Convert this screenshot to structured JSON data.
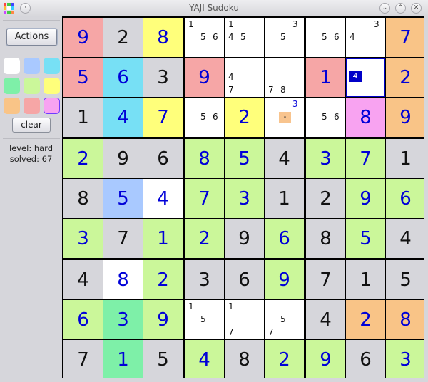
{
  "window": {
    "title": "YAJI Sudoku"
  },
  "colors": {
    "white": "#ffffff",
    "gray": "#d6d6db",
    "blue": "#a9c9ff",
    "cyan": "#77e0f5",
    "green": "#7ef0a8",
    "lime": "#cbf79a",
    "yellow": "#ffff7b",
    "orange": "#f9c487",
    "red": "#f6a6a6",
    "pink": "#f8a3f1"
  },
  "sidebar": {
    "actions_label": "Actions",
    "palette": [
      {
        "name": "white",
        "color": "#ffffff",
        "selected": false
      },
      {
        "name": "blue",
        "color": "#a9c9ff",
        "selected": false
      },
      {
        "name": "cyan",
        "color": "#77e0f5",
        "selected": false
      },
      {
        "name": "green",
        "color": "#7ef0a8",
        "selected": false
      },
      {
        "name": "lime",
        "color": "#cbf79a",
        "selected": false
      },
      {
        "name": "yellow",
        "color": "#ffff7b",
        "selected": false
      },
      {
        "name": "orange",
        "color": "#f9c487",
        "selected": false
      },
      {
        "name": "red",
        "color": "#f6a6a6",
        "selected": false
      },
      {
        "name": "pink",
        "color": "#f8a3f1",
        "selected": true
      }
    ],
    "clear_label": "clear",
    "level_text": "level: hard",
    "solved_text": "solved: 67"
  },
  "grid": {
    "rows": [
      [
        {
          "v": "9",
          "kind": "entered",
          "bg": "red"
        },
        {
          "v": "2",
          "kind": "given",
          "bg": "gray"
        },
        {
          "v": "8",
          "kind": "entered",
          "bg": "yellow"
        },
        {
          "v": "",
          "bg": "white",
          "cands": [
            "1",
            "5",
            "6"
          ]
        },
        {
          "v": "",
          "bg": "white",
          "cands": [
            "1",
            "4",
            "5"
          ]
        },
        {
          "v": "",
          "bg": "white",
          "cands": [
            "3",
            "5"
          ]
        },
        {
          "v": "",
          "bg": "white",
          "cands": [
            "5",
            "6"
          ]
        },
        {
          "v": "",
          "bg": "white",
          "cands": [
            "3",
            "4"
          ]
        },
        {
          "v": "7",
          "kind": "entered",
          "bg": "orange"
        }
      ],
      [
        {
          "v": "5",
          "kind": "entered",
          "bg": "red"
        },
        {
          "v": "6",
          "kind": "entered",
          "bg": "cyan"
        },
        {
          "v": "3",
          "kind": "given",
          "bg": "gray"
        },
        {
          "v": "9",
          "kind": "entered",
          "bg": "red"
        },
        {
          "v": "",
          "bg": "white",
          "cands": [
            "4",
            "7"
          ]
        },
        {
          "v": "",
          "bg": "white",
          "cands": [
            "7",
            "8"
          ]
        },
        {
          "v": "1",
          "kind": "entered",
          "bg": "red"
        },
        {
          "v": "",
          "bg": "white",
          "cursor": true,
          "cursor_text": "4"
        },
        {
          "v": "2",
          "kind": "entered",
          "bg": "orange"
        }
      ],
      [
        {
          "v": "1",
          "kind": "given",
          "bg": "gray"
        },
        {
          "v": "4",
          "kind": "entered",
          "bg": "cyan"
        },
        {
          "v": "7",
          "kind": "entered",
          "bg": "yellow"
        },
        {
          "v": "",
          "bg": "white",
          "cands": [
            "5",
            "6"
          ]
        },
        {
          "v": "2",
          "kind": "entered",
          "bg": "yellow"
        },
        {
          "v": "",
          "bg": "white",
          "cands": [
            "3"
          ],
          "blue_cands": true,
          "tag": "-"
        },
        {
          "v": "",
          "bg": "white",
          "cands": [
            "5",
            "6"
          ]
        },
        {
          "v": "8",
          "kind": "entered",
          "bg": "pink"
        },
        {
          "v": "9",
          "kind": "entered",
          "bg": "orange"
        }
      ],
      [
        {
          "v": "2",
          "kind": "entered",
          "bg": "lime"
        },
        {
          "v": "9",
          "kind": "given",
          "bg": "gray"
        },
        {
          "v": "6",
          "kind": "given",
          "bg": "gray"
        },
        {
          "v": "8",
          "kind": "entered",
          "bg": "lime"
        },
        {
          "v": "5",
          "kind": "entered",
          "bg": "lime"
        },
        {
          "v": "4",
          "kind": "given",
          "bg": "gray"
        },
        {
          "v": "3",
          "kind": "entered",
          "bg": "lime"
        },
        {
          "v": "7",
          "kind": "entered",
          "bg": "lime"
        },
        {
          "v": "1",
          "kind": "given",
          "bg": "gray"
        }
      ],
      [
        {
          "v": "8",
          "kind": "given",
          "bg": "gray"
        },
        {
          "v": "5",
          "kind": "entered",
          "bg": "blue"
        },
        {
          "v": "4",
          "kind": "entered",
          "bg": "white"
        },
        {
          "v": "7",
          "kind": "entered",
          "bg": "lime"
        },
        {
          "v": "3",
          "kind": "entered",
          "bg": "lime"
        },
        {
          "v": "1",
          "kind": "given",
          "bg": "gray"
        },
        {
          "v": "2",
          "kind": "given",
          "bg": "gray"
        },
        {
          "v": "9",
          "kind": "entered",
          "bg": "lime"
        },
        {
          "v": "6",
          "kind": "entered",
          "bg": "lime"
        }
      ],
      [
        {
          "v": "3",
          "kind": "entered",
          "bg": "lime"
        },
        {
          "v": "7",
          "kind": "given",
          "bg": "gray"
        },
        {
          "v": "1",
          "kind": "entered",
          "bg": "lime"
        },
        {
          "v": "2",
          "kind": "entered",
          "bg": "lime"
        },
        {
          "v": "9",
          "kind": "given",
          "bg": "gray"
        },
        {
          "v": "6",
          "kind": "entered",
          "bg": "lime"
        },
        {
          "v": "8",
          "kind": "given",
          "bg": "gray"
        },
        {
          "v": "5",
          "kind": "entered",
          "bg": "lime"
        },
        {
          "v": "4",
          "kind": "given",
          "bg": "gray"
        }
      ],
      [
        {
          "v": "4",
          "kind": "given",
          "bg": "gray"
        },
        {
          "v": "8",
          "kind": "entered",
          "bg": "white"
        },
        {
          "v": "2",
          "kind": "entered",
          "bg": "lime"
        },
        {
          "v": "3",
          "kind": "given",
          "bg": "gray"
        },
        {
          "v": "6",
          "kind": "given",
          "bg": "gray"
        },
        {
          "v": "9",
          "kind": "entered",
          "bg": "lime"
        },
        {
          "v": "7",
          "kind": "given",
          "bg": "gray"
        },
        {
          "v": "1",
          "kind": "given",
          "bg": "gray"
        },
        {
          "v": "5",
          "kind": "given",
          "bg": "gray"
        }
      ],
      [
        {
          "v": "6",
          "kind": "entered",
          "bg": "lime"
        },
        {
          "v": "3",
          "kind": "entered",
          "bg": "green"
        },
        {
          "v": "9",
          "kind": "entered",
          "bg": "lime"
        },
        {
          "v": "",
          "bg": "white",
          "cands": [
            "1",
            "5"
          ]
        },
        {
          "v": "",
          "bg": "white",
          "cands": [
            "1",
            "7"
          ]
        },
        {
          "v": "",
          "bg": "white",
          "cands": [
            "5",
            "7"
          ]
        },
        {
          "v": "4",
          "kind": "given",
          "bg": "gray"
        },
        {
          "v": "2",
          "kind": "entered",
          "bg": "orange"
        },
        {
          "v": "8",
          "kind": "entered",
          "bg": "orange"
        }
      ],
      [
        {
          "v": "7",
          "kind": "given",
          "bg": "gray"
        },
        {
          "v": "1",
          "kind": "entered",
          "bg": "green"
        },
        {
          "v": "5",
          "kind": "given",
          "bg": "gray"
        },
        {
          "v": "4",
          "kind": "entered",
          "bg": "lime"
        },
        {
          "v": "8",
          "kind": "given",
          "bg": "gray"
        },
        {
          "v": "2",
          "kind": "entered",
          "bg": "lime"
        },
        {
          "v": "9",
          "kind": "entered",
          "bg": "lime"
        },
        {
          "v": "6",
          "kind": "given",
          "bg": "gray"
        },
        {
          "v": "3",
          "kind": "entered",
          "bg": "lime"
        }
      ]
    ]
  }
}
